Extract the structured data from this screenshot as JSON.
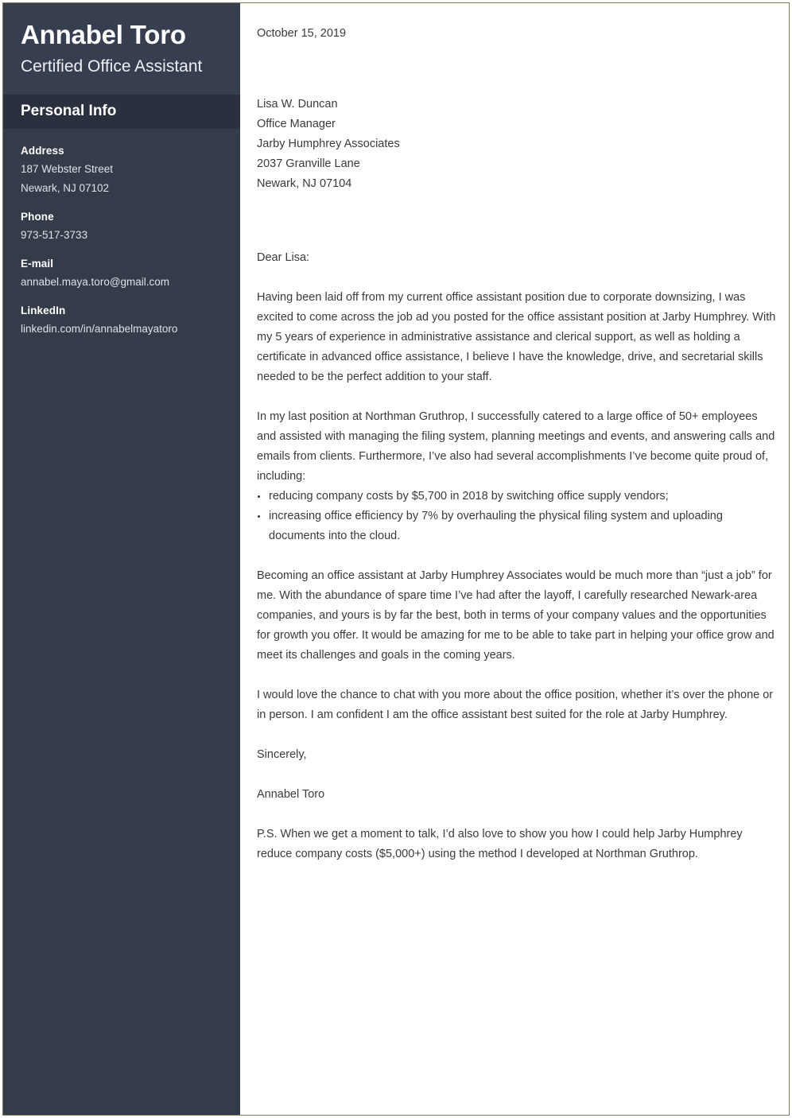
{
  "document": {
    "type": "cover-letter"
  },
  "sidebar": {
    "full_name": "Annabel Toro",
    "job_title": "Certified Office Assistant",
    "section_title": "Personal Info",
    "info": [
      {
        "label": "Address",
        "lines": [
          "187 Webster Street",
          "Newark, NJ 07102"
        ]
      },
      {
        "label": "Phone",
        "lines": [
          "973-517-3733"
        ]
      },
      {
        "label": "E-mail",
        "lines": [
          "annabel.maya.toro@gmail.com"
        ]
      },
      {
        "label": "LinkedIn",
        "lines": [
          "linkedin.com/in/annabelmayatoro"
        ]
      }
    ]
  },
  "letter": {
    "date": "October 15, 2019",
    "recipient": [
      "Lisa W. Duncan",
      "Office Manager",
      "Jarby Humphrey Associates",
      "2037 Granville Lane",
      "Newark, NJ 07104"
    ],
    "salutation": "Dear Lisa:",
    "paragraph_1": "Having been laid off from my current office assistant position due to corporate downsizing, I was excited to come across the job ad you posted for the office assistant position at Jarby Humphrey. With my 5 years of experience in administrative assistance and clerical support, as well as holding a certificate in advanced office assistance, I believe I have the knowledge, drive, and secretarial skills needed to be the perfect addition to your staff.",
    "paragraph_2": "In my last position at Northman Gruthrop, I successfully catered to a large office of 50+ employees and assisted with managing the filing system, planning meetings and events, and answering calls and emails from clients. Furthermore, I’ve also had several accomplishments I’ve become quite proud of, including:",
    "bullets": [
      "reducing company costs by $5,700 in 2018 by switching office supply vendors;",
      "increasing office efficiency by 7% by overhauling the physical filing system and uploading documents into the cloud."
    ],
    "paragraph_3": "Becoming an office assistant at Jarby Humphrey Associates would be much more than “just a job” for me. With the abundance of spare time I’ve had after the layoff, I carefully researched Newark-area companies, and yours is by far the best, both in terms of your company values and the opportunities for growth you offer. It would be amazing for me to be able to take part in helping your office grow and meet its challenges and goals in the coming years.",
    "paragraph_4": "I would love the chance to chat with you more about the office position, whether it’s over the phone or in person. I am confident I am the office assistant best suited for the role at Jarby Humphrey.",
    "closing": "Sincerely,",
    "signature": "Annabel Toro",
    "postscript": "P.S. When we get a moment to talk, I’d also love to show you how I could help Jarby Humphrey reduce company costs ($5,000+) using the method I developed at Northman Gruthrop."
  },
  "colors": {
    "sidebar_body": "#343b49",
    "sidebar_header": "#363e50",
    "section_band": "#2a303d",
    "page_border": "#7d7a5c",
    "body_text": "#3a3a3a"
  }
}
